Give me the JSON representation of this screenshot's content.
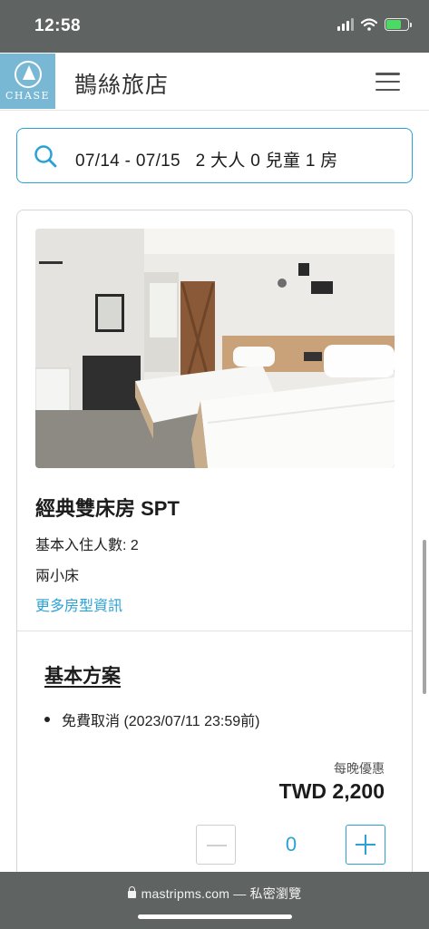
{
  "status_bar": {
    "time": "12:58",
    "signal_icon": "cellular-signal-icon",
    "wifi_icon": "wifi-icon",
    "battery_icon": "battery-charging-icon"
  },
  "header": {
    "logo_text": "CHASE",
    "hotel_name": "鵲絲旅店",
    "menu_icon": "hamburger-menu-icon"
  },
  "search": {
    "icon": "search-icon",
    "summary": "07/14 - 07/15   2 大人 0 兒童 1 房"
  },
  "room": {
    "photo": "hotel-room-photo",
    "title": "經典雙床房 SPT",
    "occupancy": "基本入住人數: 2",
    "beds": "兩小床",
    "more_info": "更多房型資訊"
  },
  "plan": {
    "title": "基本方案",
    "policy": "免費取消 (2023/07/11 23:59前)",
    "price_caption": "每晚優惠",
    "price": "TWD 2,200",
    "quantity": "0"
  },
  "browser": {
    "url": "mastripms.com — 私密瀏覽"
  },
  "colors": {
    "accent": "#2aa2d6",
    "logo_bg": "#79b8d4",
    "chrome": "#5f6361"
  }
}
